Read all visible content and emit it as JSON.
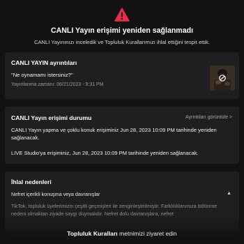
{
  "header": {
    "close_glyph": "ˇ",
    "warning_icon": "warning-triangle-icon",
    "accent_color": "#e32f45",
    "title": "CANLI Yayın erişimi yeniden sağlanmadı",
    "subtitle": "CANLI Yayınınızı inceledik ve Topluluk Kurallarımızı ihlal ettiğini tespit ettik."
  },
  "details": {
    "heading": "CANLI YAYIN ayrıntıları",
    "quote": "\"Ne oynamamı istersiniz?\"",
    "published": "Yayınlanma zamanı: 06/21/2023 - 9:31 PM",
    "thumbnail_icon": "hidden-content-icon"
  },
  "status": {
    "heading": "CANLI Yayın erişimi durumu",
    "view_details": "Ayrıntıları görüntüle >",
    "line1": "CANLI Yayın yapma ve çoklu konuk erişiminiz Jun 28, 2023 10:09 PM tarihinde yeniden sağlanacak.",
    "line2": "LIVE Studio'ya erişiminiz, Jun 28, 2023 10:09 PM tarihinde yeniden sağlanacak."
  },
  "violations": {
    "heading": "İhlal nedenleri",
    "reason_title": "Nefret içerikli konuşma veya davranışlar",
    "reason_text": "TikTok, topluluk üyelerimizin çeşitli geçmişleri ile zenginleştirilmiştir. Farklılıklarımıza bölünme nedeni olmaktan ziyade saygı duymalıdır. Nefret dolu davranışlara, nefret"
  },
  "footer": {
    "link": "Topluluk Kuralları",
    "rest": " metnimizi ziyaret edin"
  }
}
